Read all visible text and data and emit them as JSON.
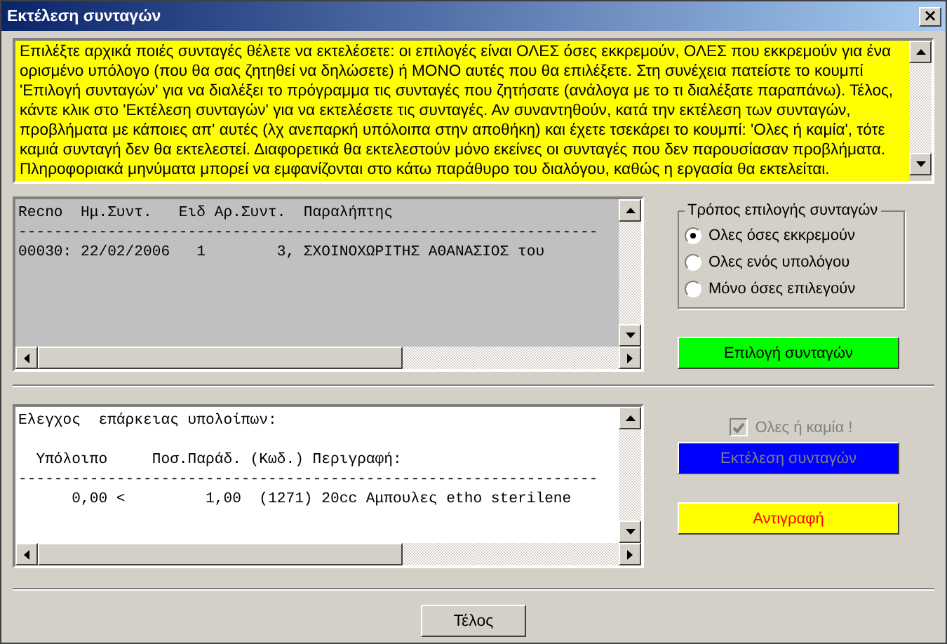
{
  "window": {
    "title": "Εκτέλεση συνταγών",
    "close": "×"
  },
  "instructions": "Επιλέξτε αρχικά ποιές συνταγές θέλετε να εκτελέσετε: οι επιλογές είναι ΟΛΕΣ όσες εκκρεμούν, ΟΛΕΣ που εκκρεμούν για ένα ορισμένο υπόλογο (που θα σας ζητηθεί να δηλώσετε) ή ΜΟΝΟ αυτές που θα επιλέξετε. Στη συνέχεια πατείστε το κουμπί 'Επιλογή συνταγών' για να διαλέξει το πρόγραμμα τις συνταγές που ζητήσατε (ανάλογα με το τι διαλέξατε παραπάνω). Τέλος, κάντε κλικ στο 'Εκτέλεση συνταγών' για να εκτελέσετε τις συνταγές. Αν συναντηθούν, κατά την εκτέλεση των συνταγών, προβλήματα με κάποιες απ' αυτές (λχ ανεπαρκή υπόλοιπα στην αποθήκη) και έχετε τσεκάρει το κουμπί: 'Ολες ή καμία', τότε καμιά συνταγή δεν θα εκτελεστεί. Διαφορετικά θα εκτελεστούν μόνο εκείνες οι συνταγές που δεν παρουσίασαν προβλήματα. Πληροφοριακά μηνύματα μπορεί να εμφανίζονται στο κάτω παράθυρο του διαλόγου, καθώς η εργασία θα εκτελείται.",
  "prescription_list": {
    "lines": [
      "Recno  Ημ.Συντ.   Ειδ Αρ.Συντ.  Παραλήπτης",
      "-----------------------------------------------------------------",
      "00030: 22/02/2006   1        3, ΣΧΟΙΝΟΧΩΡΙΤΗΣ ΑΘΑΝΑΣΙΟΣ του"
    ]
  },
  "selection_mode": {
    "title": "Τρόπος επιλογής συνταγών",
    "options": [
      {
        "label": "Ολες όσες εκκρεμούν",
        "selected": true
      },
      {
        "label": "Ολες ενός υπολόγου",
        "selected": false
      },
      {
        "label": "Μόνο όσες επιλεγούν",
        "selected": false
      }
    ]
  },
  "select_button": {
    "label": "Επιλογή συνταγών",
    "color": "#00ff00",
    "disabled": false
  },
  "log": {
    "title": "Ελεγχος  επάρκειας υπολοίπων:",
    "lines": [
      "  Υπόλοιπο     Ποσ.Παράδ. (Κωδ.) Περιγραφή:",
      "-----------------------------------------------------------------",
      "      0,00 <         1,00  (1271) 20cc Αμπουλες etho sterilene"
    ]
  },
  "all_or_none": {
    "label": "Ολες ή καμία !",
    "checked": true,
    "disabled": true
  },
  "action_buttons": [
    {
      "label": "Εκτέλεση συνταγών",
      "color": "#0000ff",
      "disabled": true
    },
    {
      "label": "Αντιγραφή",
      "color": "#ffff00",
      "disabled": false
    }
  ],
  "close_button": {
    "label": "Τέλος"
  }
}
